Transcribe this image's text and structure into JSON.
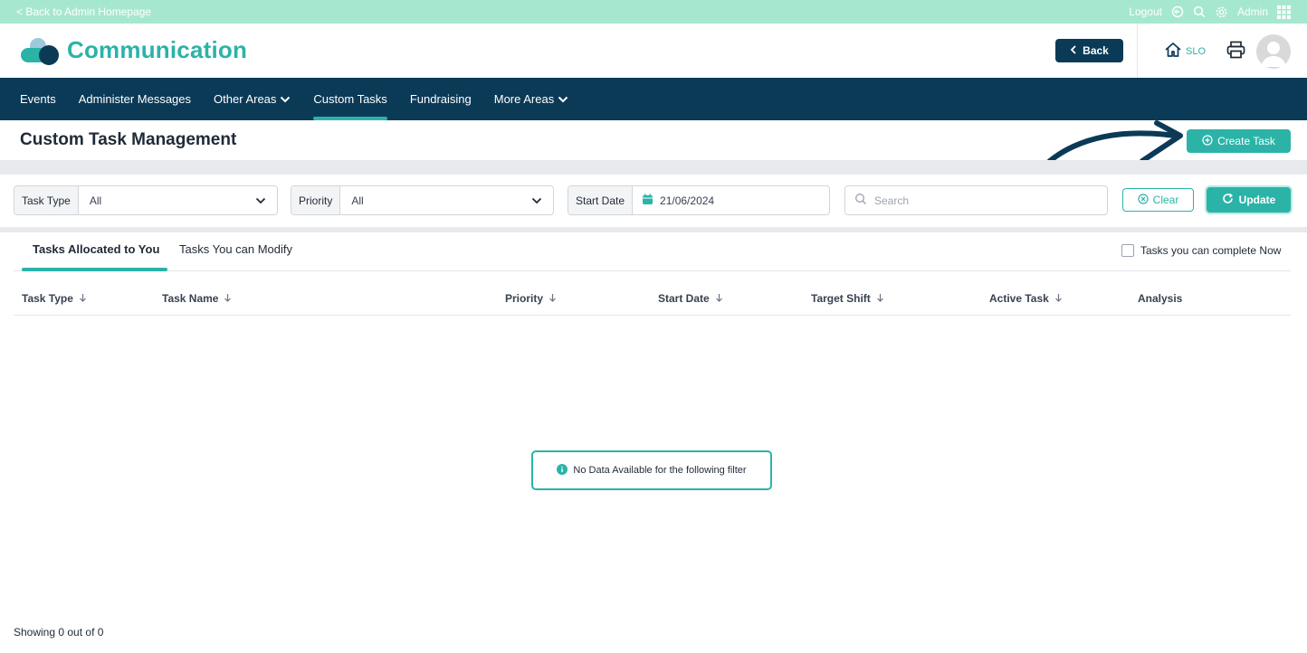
{
  "topbar": {
    "back_link": "< Back to Admin Homepage",
    "logout": "Logout",
    "user": "Admin"
  },
  "header": {
    "app_title": "Communication",
    "back_button": "Back",
    "home_label": "SLO"
  },
  "nav": {
    "items": [
      {
        "label": "Events"
      },
      {
        "label": "Administer Messages"
      },
      {
        "label": "Other Areas"
      },
      {
        "label": "Custom Tasks"
      },
      {
        "label": "Fundraising"
      },
      {
        "label": "More Areas"
      }
    ]
  },
  "page": {
    "title": "Custom Task Management",
    "create_button": "Create Task"
  },
  "filters": {
    "task_type_label": "Task Type",
    "task_type_value": "All",
    "priority_label": "Priority",
    "priority_value": "All",
    "start_date_label": "Start Date",
    "start_date_value": "21/06/2024",
    "search_placeholder": "Search",
    "clear_button": "Clear",
    "update_button": "Update"
  },
  "tabs": {
    "allocated": "Tasks Allocated to You",
    "modify": "Tasks You can Modify",
    "complete_now": "Tasks you can complete Now"
  },
  "table": {
    "columns": [
      "Task Type",
      "Task Name",
      "Priority",
      "Start Date",
      "Target Shift",
      "Active Task",
      "Analysis"
    ]
  },
  "empty_message": "No Data Available for the following filter",
  "footer": {
    "count_text": "Showing 0 out of 0"
  },
  "colors": {
    "brand_teal": "#2bb3a8",
    "navy": "#0b3a57",
    "top_strip": "#a6e8cf"
  }
}
